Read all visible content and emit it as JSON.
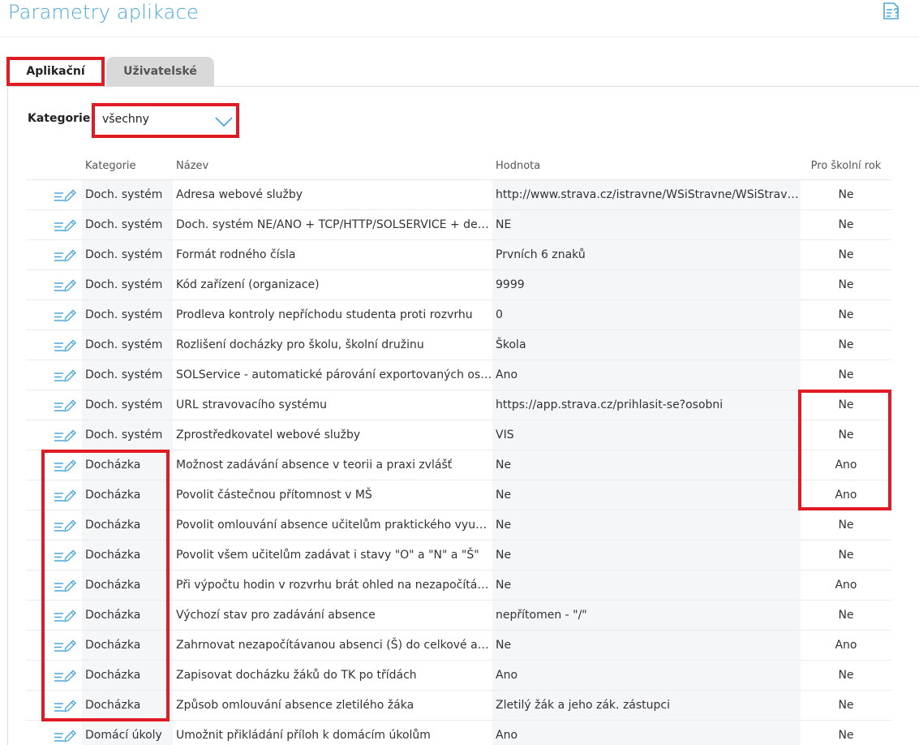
{
  "page": {
    "title": "Parametry aplikace",
    "help_icon": "help-document-icon"
  },
  "tabs": [
    {
      "label": "Aplikační",
      "active": true
    },
    {
      "label": "Uživatelské",
      "active": false
    }
  ],
  "filter": {
    "label": "Kategorie:",
    "value": "všechny",
    "icon": "chevron-down-icon"
  },
  "grid": {
    "columns": {
      "category": "Kategorie",
      "name": "Název",
      "value": "Hodnota",
      "school_year": "Pro školní rok"
    },
    "edit_icon": "edit-list-pencil-icon",
    "rows": [
      {
        "category": "Doch. systém",
        "name": "Adresa webové služby",
        "value": "http://www.strava.cz/istravne/WSiStravne/WSiStravne.asmx",
        "school_year": "Ne"
      },
      {
        "category": "Doch. systém",
        "name": "Doch. systém NE/ANO + TCP/HTTP/SOLSERVICE + definice",
        "value": "NE",
        "school_year": "Ne"
      },
      {
        "category": "Doch. systém",
        "name": "Formát rodného čísla",
        "value": "Prvních 6 znaků",
        "school_year": "Ne"
      },
      {
        "category": "Doch. systém",
        "name": "Kód zařízení (organizace)",
        "value": "9999",
        "school_year": "Ne"
      },
      {
        "category": "Doch. systém",
        "name": "Prodleva kontroly nepříchodu studenta proti rozvrhu",
        "value": "0",
        "school_year": "Ne"
      },
      {
        "category": "Doch. systém",
        "name": "Rozlišení docházky pro školu, školní družinu",
        "value": "Škola",
        "school_year": "Ne"
      },
      {
        "category": "Doch. systém",
        "name": "SOLService - automatické párování exportovaných osob",
        "value": "Ano",
        "school_year": "Ne"
      },
      {
        "category": "Doch. systém",
        "name": "URL stravovacího systému",
        "value": "https://app.strava.cz/prihlasit-se?osobni",
        "school_year": "Ne"
      },
      {
        "category": "Doch. systém",
        "name": "Zprostředkovatel webové služby",
        "value": "VIS",
        "school_year": "Ne"
      },
      {
        "category": "Docházka",
        "name": "Možnost zadávání absence v teorii a praxi zvlášť",
        "value": "Ne",
        "school_year": "Ano"
      },
      {
        "category": "Docházka",
        "name": "Povolit částečnou přítomnost v MŠ",
        "value": "Ne",
        "school_year": "Ano"
      },
      {
        "category": "Docházka",
        "name": "Povolit omlouvání absence učitelům praktického vyučování",
        "value": "Ne",
        "school_year": "Ne"
      },
      {
        "category": "Docházka",
        "name": "Povolit všem učitelům zadávat i stavy \"O\" a \"N\" a \"Š\"",
        "value": "Ne",
        "school_year": "Ne"
      },
      {
        "category": "Docházka",
        "name": "Při výpočtu hodin v rozvrhu brát ohled na nezapočítávanou absenci",
        "value": "Ne",
        "school_year": "Ano"
      },
      {
        "category": "Docházka",
        "name": "Výchozí stav pro zadávání absence",
        "value": "nepřítomen - \"/\"",
        "school_year": "Ne"
      },
      {
        "category": "Docházka",
        "name": "Zahrnovat nezapočítávanou absenci (Š) do celkové absence",
        "value": "Ne",
        "school_year": "Ano"
      },
      {
        "category": "Docházka",
        "name": "Zapisovat docházku žáků do TK po třídách",
        "value": "Ano",
        "school_year": "Ne"
      },
      {
        "category": "Docházka",
        "name": "Způsob omlouvání absence zletilého žáka",
        "value": "Zletilý žák a jeho zák. zástupci",
        "school_year": "Ne"
      },
      {
        "category": "Domácí úkoly",
        "name": "Umožnit přikládání příloh k domácím úkolům",
        "value": "Ano",
        "school_year": "Ne"
      }
    ]
  }
}
